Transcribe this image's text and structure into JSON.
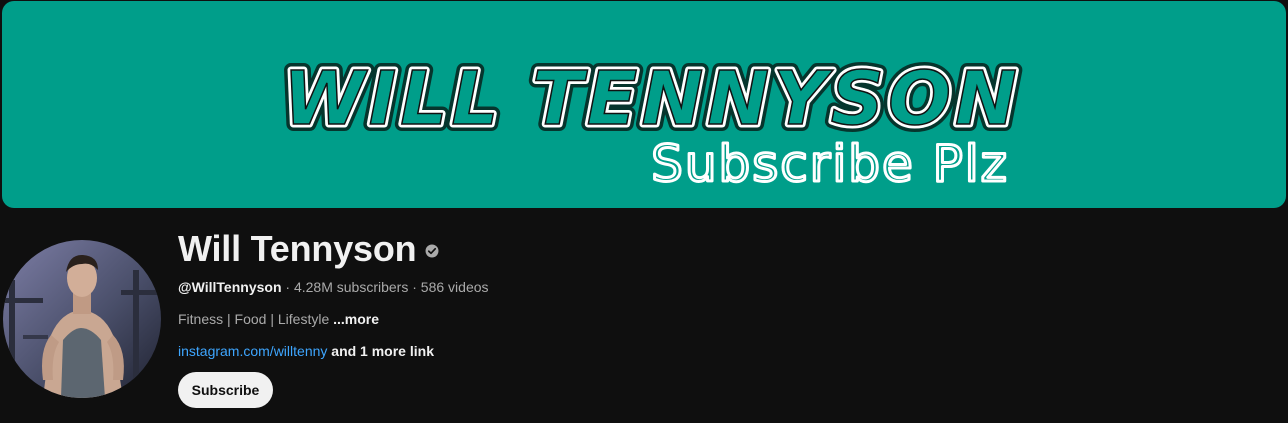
{
  "banner": {
    "title": "WILL TENNYSON",
    "subtitle": "Subscribe Plz",
    "background_color": "#009e8a"
  },
  "channel": {
    "name": "Will Tennyson",
    "verified_icon": "verified-check-icon",
    "handle": "@WillTennyson",
    "subscribers": "4.28M subscribers",
    "videos": "586 videos",
    "separator": "·",
    "description": "Fitness | Food | Lifestyle",
    "more_label": "...more",
    "link_text": "instagram.com/willtenny",
    "more_links_label": "and 1 more link",
    "subscribe_label": "Subscribe"
  },
  "colors": {
    "background": "#0f0f0f",
    "text_primary": "#f1f1f1",
    "text_secondary": "#aaaaaa",
    "link": "#3ea6ff"
  }
}
